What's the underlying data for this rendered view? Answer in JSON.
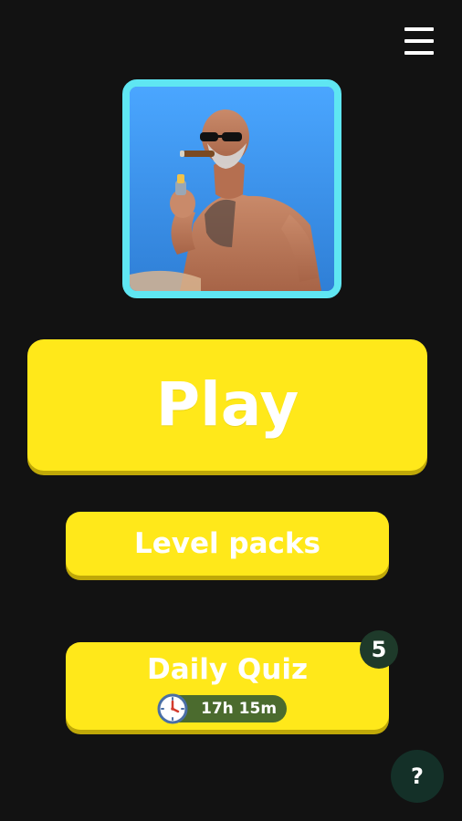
{
  "header": {
    "menu_icon": "hamburger-menu-icon"
  },
  "portrait": {
    "frame_color": "#5fe6f2",
    "background_color": "#3f8fe0"
  },
  "buttons": {
    "play_label": "Play",
    "level_packs_label": "Level packs",
    "daily_quiz_label": "Daily Quiz",
    "daily_quiz_timer": "17h 15m",
    "daily_quiz_badge": "5",
    "help_label": "?"
  },
  "colors": {
    "background": "#121212",
    "button_yellow": "#ffe81a",
    "timer_pill": "#4b6b2e",
    "badge": "#1e3a2a",
    "help_button": "#143028"
  }
}
